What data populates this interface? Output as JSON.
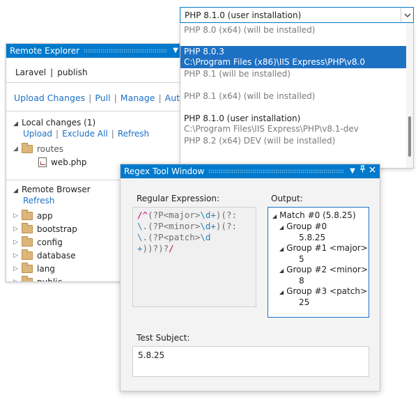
{
  "php_select": {
    "current": "PHP 8.1.0 (user installation)",
    "options": [
      {
        "line1": "PHP 8.0 (x64) (will be installed)",
        "line2": ""
      },
      {
        "line1": "PHP 8.0.3",
        "line2": "C:\\Program Files (x86)\\IIS Express\\PHP\\v8.0"
      },
      {
        "line1": "PHP 8.1 (will be installed)",
        "line2": ""
      },
      {
        "line1": "PHP 8.1 (x64) (will be installed)",
        "line2": ""
      },
      {
        "line1": "PHP 8.1.0 (user installation)",
        "line2": "C:\\Program Files\\IIS Express\\PHP\\v8.1-dev"
      },
      {
        "line1": "PHP 8.2 (x64) DEV (will be installed)",
        "line2": ""
      }
    ]
  },
  "remote_explorer": {
    "title": "Remote Explorer",
    "connection": {
      "project": "Laravel",
      "profile": "publish",
      "separator": "|"
    },
    "actions": [
      "Upload Changes",
      "Pull",
      "Manage",
      "Auto"
    ],
    "local_changes": {
      "heading": "Local changes (1)",
      "links": [
        "Upload",
        "Exclude All",
        "Refresh"
      ],
      "folder": "routes",
      "file": "web.php"
    },
    "remote_browser": {
      "heading": "Remote Browser",
      "refresh": "Refresh",
      "folders": [
        "app",
        "bootstrap",
        "config",
        "database",
        "lang",
        "public"
      ]
    }
  },
  "regex_window": {
    "title": "Regex Tool Window",
    "regex_label": "Regular Expression:",
    "output_label": "Output:",
    "test_label": "Test Subject:",
    "test_value": "5.8.25",
    "output": {
      "match": "Match #0 (5.8.25)",
      "match_value": "",
      "groups": [
        {
          "label": "Group #0",
          "value": "5.8.25"
        },
        {
          "label": "Group #1 <major>",
          "value": "5"
        },
        {
          "label": "Group #2 <minor>",
          "value": "8"
        },
        {
          "label": "Group #3 <patch>",
          "value": "25"
        }
      ]
    },
    "regex_tokens": {
      "l1a": "/^",
      "l1b": "(?P<major>",
      "l1c": "\\d+",
      "l1d": ")(?:",
      "l2a": "\\.",
      "l2b": "(?P<minor>",
      "l2c": "\\d+",
      "l2d": ")(?:",
      "l3a": "\\.",
      "l3b": "(?P<patch>",
      "l3c": "\\d",
      "l4a": "+",
      "l4b": "))?)?",
      "l4c": "/"
    }
  },
  "colors": {
    "accent": "#007acc",
    "link": "#1a70c6",
    "selection": "#1e70c3",
    "folder": "#dcb67a"
  },
  "icons": {
    "folder": "folder-icon",
    "file": "php-file-icon",
    "close": "close-icon",
    "pin": "pin-icon",
    "dropdown": "chevron-down-icon"
  }
}
